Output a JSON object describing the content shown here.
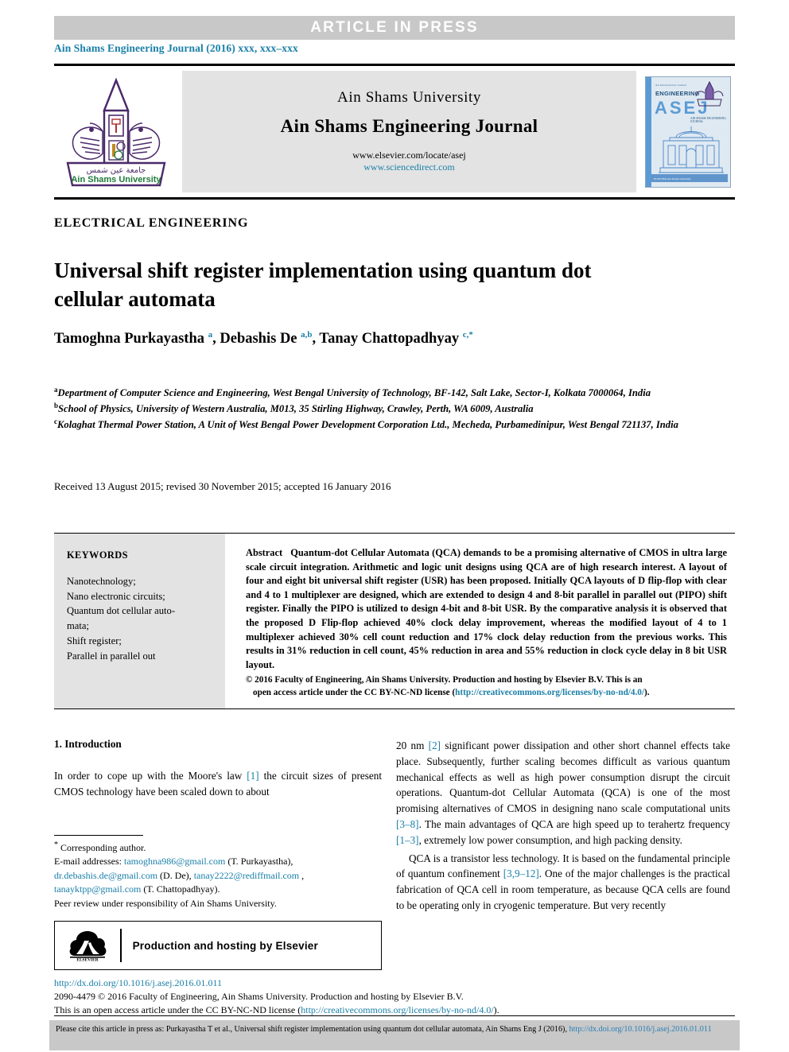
{
  "banner": {
    "text": "ARTICLE  IN  PRESS"
  },
  "running_head": "Ain Shams Engineering Journal (2016) xxx, xxx–xxx",
  "masthead": {
    "university": "Ain Shams University",
    "journal": "Ain Shams Engineering Journal",
    "url_elsevier": "www.elsevier.com/locate/asej",
    "url_sciencedirect": "www.sciencedirect.com",
    "logo_caption_arabic": "جامعة عين شمس",
    "logo_caption_english": "Ain Shams University",
    "cover": {
      "top_small": "An International Journal",
      "word_engineering": "ENGINEERING",
      "acronym": "ASEJ",
      "sub": "AIN SHAMS ENGINEERING JOURNAL",
      "footer": "ELSEVIER          Ain Shams University"
    }
  },
  "article": {
    "type": "ELECTRICAL ENGINEERING",
    "title": "Universal shift register implementation using quantum dot cellular automata",
    "authors_html": "Tamoghna Purkayastha <sup>a</sup>, Debashis De <sup>a,b</sup>, Tanay Chattopadhyay <sup>c,*</sup>",
    "affiliations": [
      {
        "mark": "a",
        "text": "Department of Computer Science and Engineering, West Bengal University of Technology, BF-142, Salt Lake, Sector-I, Kolkata 7000064, India"
      },
      {
        "mark": "b",
        "text": "School of Physics, University of Western Australia, M013, 35 Stirling Highway, Crawley, Perth, WA 6009, Australia"
      },
      {
        "mark": "c",
        "text": "Kolaghat Thermal Power Station, A Unit of West Bengal Power Development Corporation Ltd., Mecheda, Purbamedinipur, West Bengal 721137, India"
      }
    ],
    "history": "Received 13 August 2015; revised 30 November 2015; accepted 16 January 2016"
  },
  "keywords": {
    "heading": "KEYWORDS",
    "items": [
      "Nanotechnology;",
      "Nano electronic circuits;",
      "Quantum dot cellular auto-",
      "mata;",
      "Shift register;",
      "Parallel in parallel out"
    ]
  },
  "abstract": {
    "label": "Abstract",
    "text": "Quantum-dot Cellular Automata (QCA) demands to be a promising alternative of CMOS in ultra large scale circuit integration. Arithmetic and logic unit designs using QCA are of high research interest. A layout of four and eight bit universal shift register (USR) has been proposed. Initially QCA layouts of D flip-flop with clear and 4 to 1 multiplexer are designed, which are extended to design 4 and 8-bit parallel in parallel out (PIPO) shift register. Finally the PIPO is utilized to design 4-bit and 8-bit USR. By the comparative analysis it is observed that the proposed D Flip-flop achieved 40% clock delay improvement, whereas the modified layout of 4 to 1 multiplexer achieved 30% cell count reduction and 17% clock delay reduction from the previous works. This results in 31% reduction in cell count, 45% reduction in area and 55% reduction in clock cycle delay in 8 bit USR layout.",
    "copyright_line1": "© 2016 Faculty of Engineering, Ain Shams University. Production and hosting by Elsevier B.V.  This is an",
    "copyright_line2_pre": "open access article under the CC BY-NC-ND license (",
    "copyright_link": "http://creativecommons.org/licenses/by-no-nd/4.0/",
    "copyright_line2_post": ")."
  },
  "body": {
    "section_heading": "1. Introduction",
    "left_paragraph": "In order to cope up with the Moore's law [1] the circuit sizes of present CMOS technology have been scaled down to about",
    "left_ref": "[1]",
    "right_paragraphs": [
      "20 nm [2] significant power dissipation and other short channel effects take place. Subsequently, further scaling becomes difficult as various quantum mechanical effects as well as high power consumption disrupt the circuit operations. Quantum-dot Cellular Automata (QCA) is one of the most promising alternatives of CMOS in designing nano scale computational units [3–8]. The main advantages of QCA are high speed up to terahertz frequency [1–3], extremely low power consumption, and high packing density.",
      "QCA is a transistor less technology. It is based on the fundamental principle of quantum confinement [3,9–12]. One of the major challenges is the practical fabrication of QCA cell in room temperature, as because QCA cells are found to be operating only in cryogenic temperature. But very recently"
    ],
    "right_refs": [
      "[2]",
      "[3–8]",
      "[1–3]",
      "[3,9–12]"
    ]
  },
  "footnote": {
    "corresponding": "Corresponding author.",
    "email_label": "E-mail addresses:",
    "emails": [
      {
        "address": "tamoghna986@gmail.com",
        "owner": "(T. Purkayastha),"
      },
      {
        "address": "dr.debashis.de@gmail.com",
        "owner": "(D.  De),"
      },
      {
        "address": "tanay2222@rediffmail.com",
        "owner": ","
      },
      {
        "address": "tanayktpp@gmail.com",
        "owner": "(T. Chattopadhyay)."
      }
    ],
    "peer_review": "Peer review under responsibility of Ain Shams University."
  },
  "elsevier_box": {
    "logo_text": "ELSEVIER",
    "label": "Production and hosting by Elsevier"
  },
  "doi_block": {
    "doi": "http://dx.doi.org/10.1016/j.asej.2016.01.011",
    "line2": "2090-4479 © 2016 Faculty of Engineering, Ain Shams University. Production and hosting by Elsevier B.V.",
    "line3_pre": "This is an open access article under the CC BY-NC-ND license (",
    "line3_link": "http://creativecommons.org/licenses/by-no-nd/4.0/",
    "line3_post": ")."
  },
  "cite_bar": {
    "text_pre": "Please cite this article in press as: Purkayastha T et al., Universal shift register implementation using quantum dot cellular automata, Ain Shams Eng J (2016), ",
    "link": "http://dx.doi.org/10.1016/j.asej.2016.01.011"
  },
  "colors": {
    "link": "#1a7fa8",
    "banner_bg": "#c8c8c8",
    "panel_bg": "#e3e3e3",
    "logo_purple": "#4b2a6a",
    "cover_blue": "#5b9bd5"
  }
}
